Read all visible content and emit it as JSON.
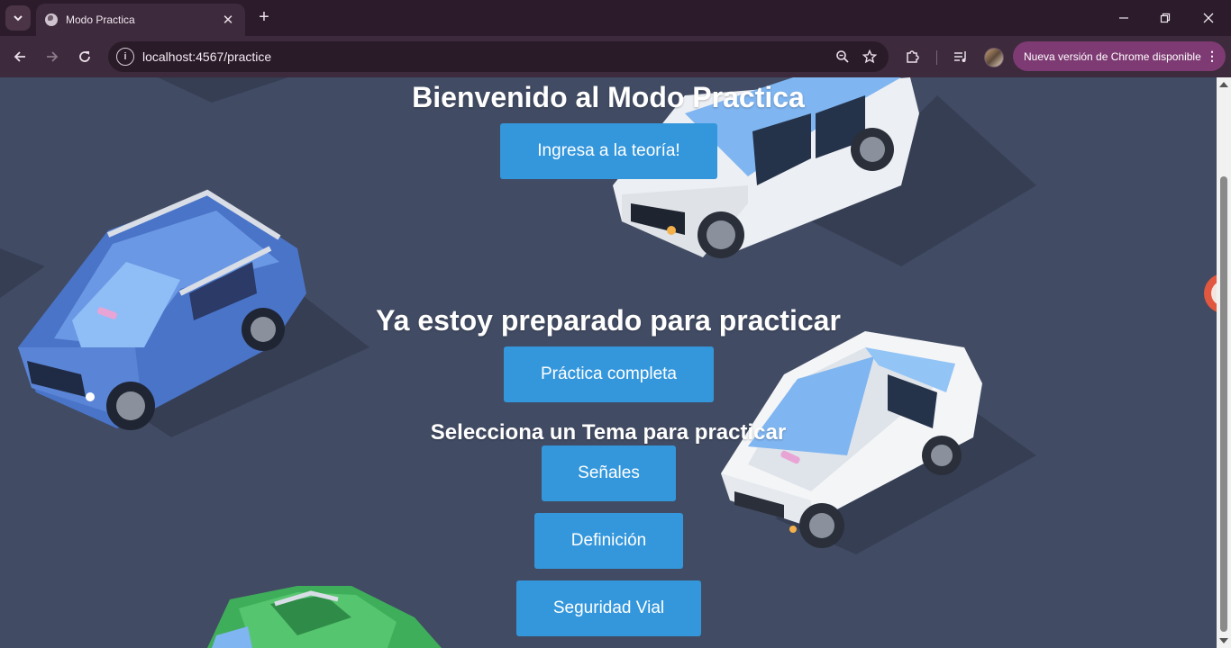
{
  "browser": {
    "tab": {
      "title": "Modo Practica",
      "favicon": "globe-icon"
    },
    "url": "localhost:4567/practice",
    "update_label": "Nueva versión de Chrome disponible",
    "icons": {
      "back": "arrow-left-icon",
      "forward": "arrow-right-icon",
      "reload": "reload-icon",
      "zoom": "zoom-icon",
      "bookmark": "star-icon",
      "extensions": "puzzle-icon",
      "media": "media-queue-icon"
    }
  },
  "page": {
    "welcome_title": "Bienvenido al Modo Practica",
    "theory_button": "Ingresa a la teoría!",
    "ready_title": "Ya estoy preparado para practicar",
    "full_practice_button": "Práctica completa",
    "select_topic_title": "Selecciona un Tema para practicar",
    "topics": [
      "Señales",
      "Definición",
      "Seguridad Vial"
    ],
    "accent_color": "#3497dc",
    "background_color": "#414b63"
  }
}
